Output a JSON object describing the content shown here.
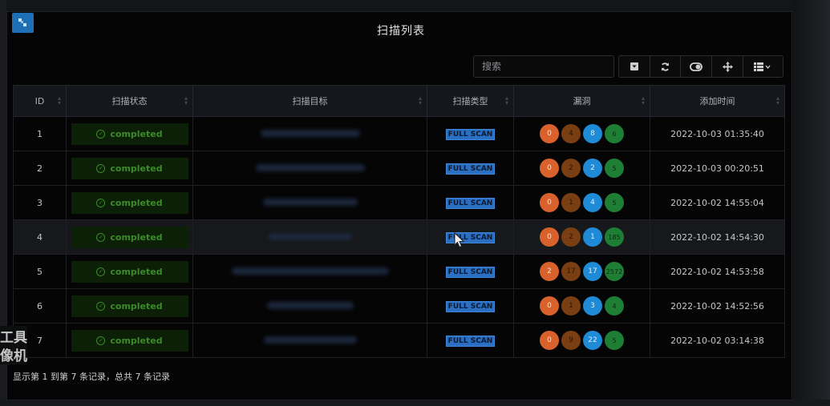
{
  "app": {
    "title": "扫描列表"
  },
  "search": {
    "placeholder": "搜索",
    "value": ""
  },
  "toolbar": {
    "icons": [
      "dropdown-icon",
      "refresh-icon",
      "toggle-icon",
      "move-icon",
      "columns-icon"
    ]
  },
  "table": {
    "headers": [
      "ID",
      "扫描状态",
      "扫描目标",
      "扫描类型",
      "漏洞",
      "添加时间"
    ],
    "rows": [
      {
        "id": "1",
        "status": "completed",
        "target": "",
        "type": "FULL SCAN",
        "vulns": [
          "0",
          "4",
          "8",
          "6"
        ],
        "time": "2022-10-03 01:35:40"
      },
      {
        "id": "2",
        "status": "completed",
        "target": "",
        "type": "FULL SCAN",
        "vulns": [
          "0",
          "2",
          "2",
          "5"
        ],
        "time": "2022-10-03 00:20:51"
      },
      {
        "id": "3",
        "status": "completed",
        "target": "",
        "type": "FULL SCAN",
        "vulns": [
          "0",
          "1",
          "4",
          "5"
        ],
        "time": "2022-10-02 14:55:04"
      },
      {
        "id": "4",
        "status": "completed",
        "target": "",
        "type": "FULL SCAN",
        "vulns": [
          "0",
          "2",
          "1",
          "185"
        ],
        "time": "2022-10-02 14:54:30"
      },
      {
        "id": "5",
        "status": "completed",
        "target": "",
        "type": "FULL SCAN",
        "vulns": [
          "2",
          "17",
          "17",
          "2572"
        ],
        "time": "2022-10-02 14:53:58"
      },
      {
        "id": "6",
        "status": "completed",
        "target": "",
        "type": "FULL SCAN",
        "vulns": [
          "0",
          "1",
          "3",
          "4"
        ],
        "time": "2022-10-02 14:52:56"
      },
      {
        "id": "7",
        "status": "completed",
        "target": "",
        "type": "FULL SCAN",
        "vulns": [
          "0",
          "9",
          "22",
          "5"
        ],
        "time": "2022-10-02 03:14:38"
      }
    ]
  },
  "footer": {
    "summary": "显示第 1 到第 7 条记录，总共 7 条记录"
  },
  "side_overlay": {
    "line1": "工具",
    "line2": "像机"
  },
  "colors": {
    "accent": "#1f6fb6",
    "status_bg": "#0c2008",
    "status_text": "#3d8a2a",
    "critical": "#d9612c",
    "high": "#7a3e13",
    "medium": "#1f8ad6",
    "low": "#1e7e34"
  }
}
